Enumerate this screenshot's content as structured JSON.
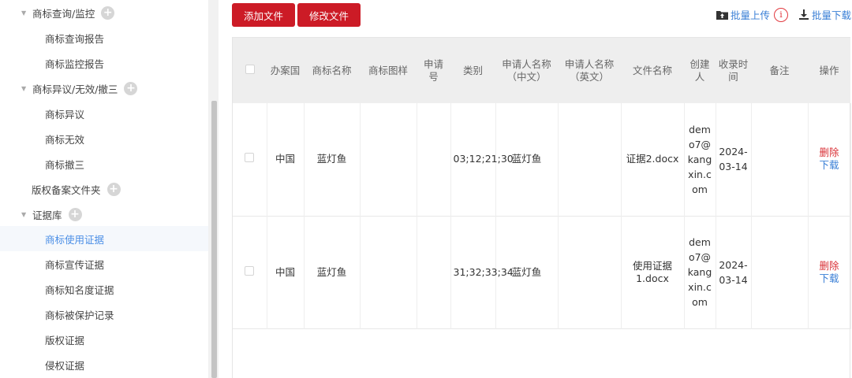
{
  "sidebar": {
    "items": [
      {
        "label": "商标查询/监控",
        "type": "group"
      },
      {
        "label": "商标查询报告",
        "type": "child"
      },
      {
        "label": "商标监控报告",
        "type": "child"
      },
      {
        "label": "商标异议/无效/撤三",
        "type": "group"
      },
      {
        "label": "商标异议",
        "type": "child"
      },
      {
        "label": "商标无效",
        "type": "child"
      },
      {
        "label": "商标撤三",
        "type": "child"
      },
      {
        "label": "版权备案文件夹",
        "type": "plain"
      },
      {
        "label": "证据库",
        "type": "group"
      },
      {
        "label": "商标使用证据",
        "type": "child",
        "active": true
      },
      {
        "label": "商标宣传证据",
        "type": "child"
      },
      {
        "label": "商标知名度证据",
        "type": "child"
      },
      {
        "label": "商标被保护记录",
        "type": "child"
      },
      {
        "label": "版权证据",
        "type": "child"
      },
      {
        "label": "侵权证据",
        "type": "child"
      }
    ]
  },
  "toolbar": {
    "add_label": "添加文件",
    "edit_label": "修改文件",
    "upload_label": "批量上传",
    "download_label": "批量下载"
  },
  "table": {
    "headers": [
      "",
      "办案国",
      "商标名称",
      "商标图样",
      "申请号",
      "类别",
      "申请人名称（中文）",
      "申请人名称（英文）",
      "文件名称",
      "创建人",
      "收录时间",
      "备注",
      "操作"
    ],
    "rows": [
      {
        "country": "中国",
        "trademark": "蓝灯鱼",
        "image": "",
        "app_no": "",
        "category": "03;12;21;30",
        "applicant_cn": "蓝灯鱼",
        "applicant_en": "",
        "file": "证据2.docx",
        "creator": "demo7@kangxin.com",
        "time": "2024-03-14",
        "note": "",
        "delete": "删除",
        "download": "下载"
      },
      {
        "country": "中国",
        "trademark": "蓝灯鱼",
        "image": "",
        "app_no": "",
        "category": "31;32;33;34",
        "applicant_cn": "蓝灯鱼",
        "applicant_en": "",
        "file": "使用证据1.docx",
        "creator": "demo7@kangxin.com",
        "time": "2024-03-14",
        "note": "",
        "delete": "删除",
        "download": "下载"
      }
    ]
  },
  "colors": {
    "primary_red": "#cc1b26",
    "link_blue": "#3a7fd6",
    "active_blue": "#4a8ee6"
  }
}
